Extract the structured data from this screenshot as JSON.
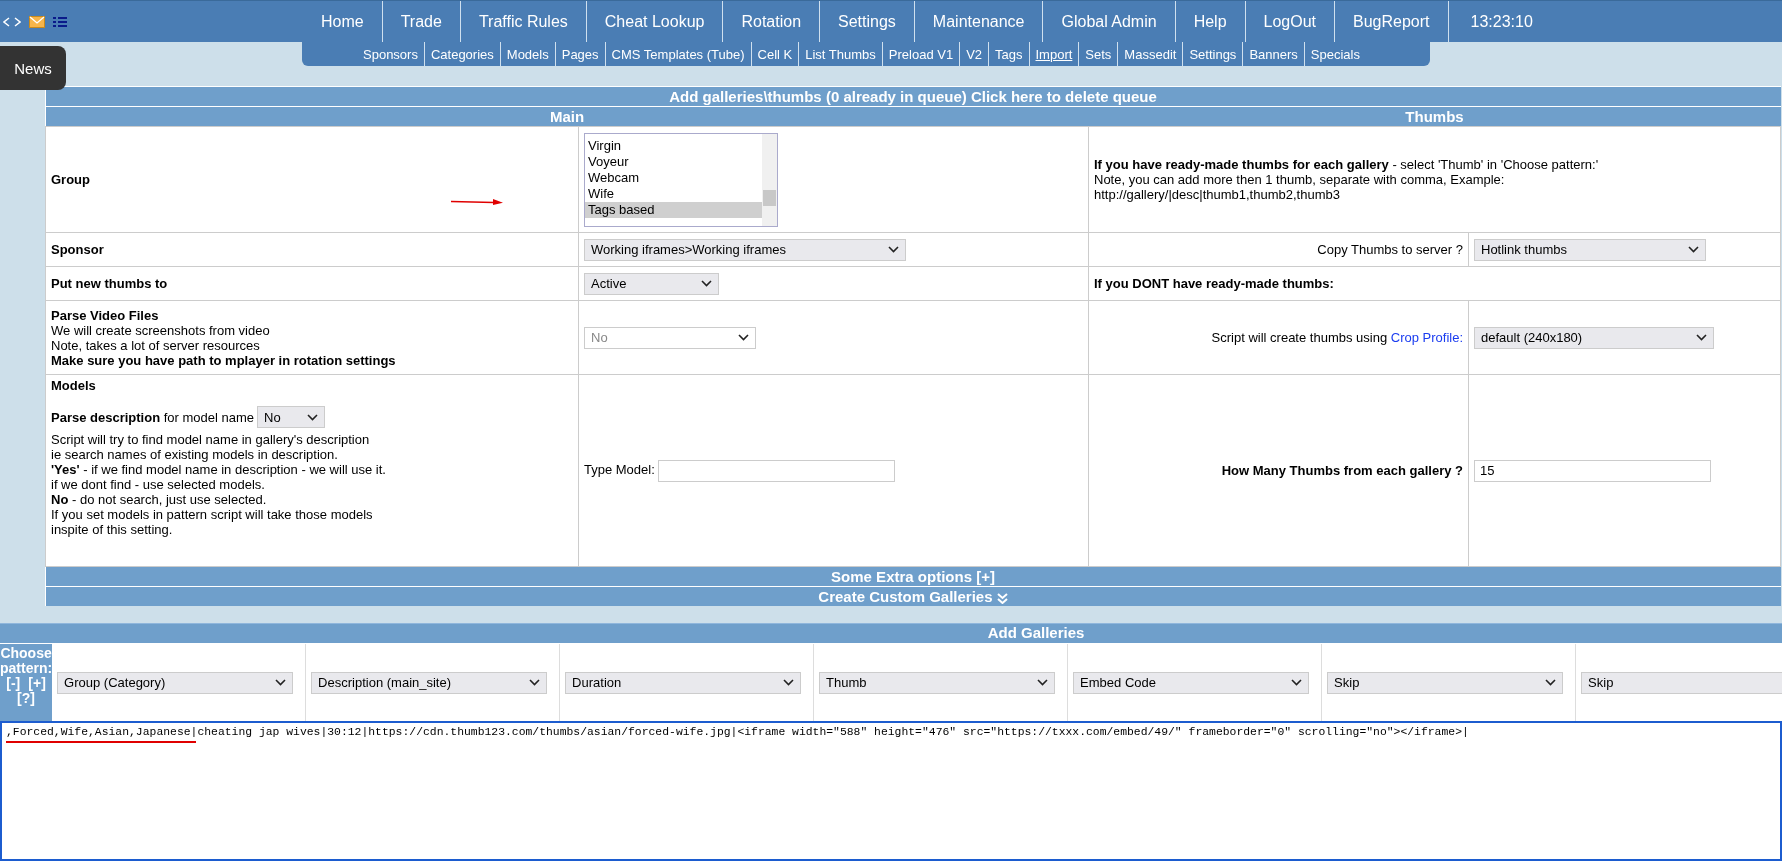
{
  "nav": [
    {
      "label": "Home"
    },
    {
      "label": "Trade"
    },
    {
      "label": "Traffic Rules"
    },
    {
      "label": "Cheat Lookup"
    },
    {
      "label": "Rotation"
    },
    {
      "label": "Settings"
    },
    {
      "label": "Maintenance"
    },
    {
      "label": "Global Admin"
    },
    {
      "label": "Help"
    },
    {
      "label": "LogOut"
    },
    {
      "label": "BugReport"
    }
  ],
  "clock": "13:23:10",
  "subnav": [
    {
      "label": "Sponsors",
      "selected": false
    },
    {
      "label": "Categories",
      "selected": false
    },
    {
      "label": "Models",
      "selected": false
    },
    {
      "label": "Pages",
      "selected": false
    },
    {
      "label": "CMS Templates (Tube)",
      "selected": false
    },
    {
      "label": "Cell K",
      "selected": false
    },
    {
      "label": "List Thumbs",
      "selected": false
    },
    {
      "label": "Preload V1",
      "selected": false
    },
    {
      "label": "V2",
      "selected": false
    },
    {
      "label": "Tags",
      "selected": false
    },
    {
      "label": "Import",
      "selected": true
    },
    {
      "label": "Sets",
      "selected": false
    },
    {
      "label": "Massedit",
      "selected": false
    },
    {
      "label": "Settings",
      "selected": false
    },
    {
      "label": "Banners",
      "selected": false
    },
    {
      "label": "Specials",
      "selected": false
    }
  ],
  "news_button": "News",
  "form": {
    "title": "Add galleries\\thumbs (0 already in queue) Click here to delete queue",
    "main_header": "Main",
    "thumbs_header": "Thumbs",
    "group": {
      "label": "Group",
      "options": [
        {
          "label": "Virgin",
          "selected": false
        },
        {
          "label": "Voyeur",
          "selected": false
        },
        {
          "label": "Webcam",
          "selected": false
        },
        {
          "label": "Wife",
          "selected": false
        },
        {
          "label": "Tags based",
          "selected": true
        }
      ]
    },
    "thumbs_info": [
      "**If you have ready-made thumbs for each gallery** - select 'Thumb' in 'Choose pattern:'",
      "Note, you can add more then 1 thumb, separate with comma, Example:",
      "http://gallery/|desc|thumb1,thumb2,thumb3"
    ],
    "sponsor": {
      "label": "Sponsor",
      "value": "Working iframes>Working iframes"
    },
    "copy_thumbs": {
      "label": "Copy Thumbs to server ?",
      "value": "Hotlink thumbs"
    },
    "put_new_thumbs": {
      "label": "Put new thumbs to",
      "value": "Active"
    },
    "no_thumbs_heading": "If you DONT have ready-made thumbs:",
    "parse_video": {
      "title": "Parse Video Files",
      "lines": [
        "We will create screenshots from video",
        "Note, takes a lot of server resources"
      ],
      "warning": "Make sure you have path to mplayer in rotation settings",
      "value": "No",
      "disabled": true
    },
    "crop": {
      "label": "Script will create thumbs using",
      "link": "Crop Profile:",
      "value": "default (240x180)"
    },
    "models": {
      "title": "Models",
      "parse_label": "**Parse description** for model name",
      "parse_value": "No",
      "lines": [
        "Script will try to find model name in gallery's description",
        "ie search names of existing models in description.",
        "**'Yes'** - if we find model name in description - we will use it.",
        "if we dont find - use selected models.",
        "**No** - do not search, just use selected.",
        "If you set models in pattern script will take those models",
        "inspite of this setting."
      ],
      "type_label": "Type Model:"
    },
    "how_many": {
      "label": "How Many Thumbs from each gallery ?",
      "value": "15"
    },
    "extra_options": "Some Extra options [+]",
    "custom_galleries": "Create Custom Galleries"
  },
  "add_galleries": {
    "title": "Add Galleries",
    "choose_label": "Choose pattern:",
    "pattern_links": [
      "[-]",
      "[+]",
      "[?]"
    ],
    "patterns": [
      "Group (Category)",
      "Description (main_site)",
      "Duration",
      "Thumb",
      "Embed Code",
      "Skip",
      "Skip"
    ],
    "text": ",Forced,Wife,Asian,Japanese|cheating jap wives|30:12|https://cdn.thumb123.com/thumbs/asian/forced-wife.jpg|<iframe width=\"588\" height=\"476\" src=\"https://txxx.com/embed/49/\" frameborder=\"0\" scrolling=\"no\"></iframe>|"
  }
}
